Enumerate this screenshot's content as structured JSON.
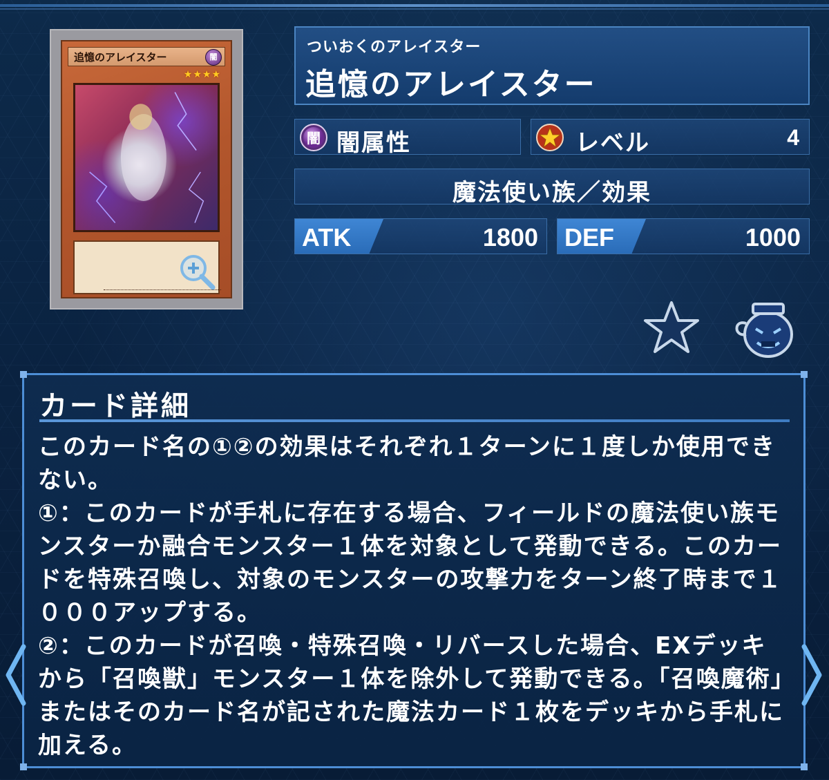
{
  "card": {
    "furigana": "ついおくのアレイスター",
    "name": "追憶のアレイスター",
    "image_name_text": "追憶のアレイスター",
    "image_attr_text": "闇",
    "image_stars": "★★★★",
    "attribute_icon_char": "闇",
    "attribute": "闇属性",
    "level_label": "レベル",
    "level": "4",
    "type": "魔法使い族／効果",
    "atk_label": "ATK",
    "atk": "1800",
    "def_label": "DEF",
    "def": "1000"
  },
  "icons": {
    "zoom": "zoom-in-icon",
    "favorite": "star-icon",
    "pot": "pot-of-greed-icon",
    "left_nav": "chevron-left-icon",
    "right_nav": "chevron-right-icon"
  },
  "details": {
    "title": "カード詳細",
    "text": "このカード名の①②の効果はそれぞれ１ターンに１度しか使用できない。\n①：このカードが手札に存在する場合、フィールドの魔法使い族モンスターか融合モンスター１体を対象として発動できる。このカードを特殊召喚し、対象のモンスターの攻撃力をターン終了時まで１０００アップする。\n②：このカードが召喚・特殊召喚・リバースした場合、EXデッキから「召喚獣」モンスター１体を除外して発動できる。「召喚魔術」またはそのカード名が記された魔法カード１枚をデッキから手札に加える。"
  },
  "colors": {
    "accent": "#4d8ed6",
    "panel": "#1e4678",
    "stat_tag": "#3f86d4"
  }
}
